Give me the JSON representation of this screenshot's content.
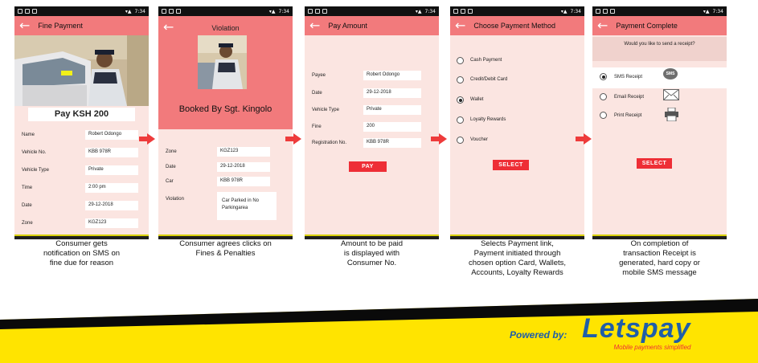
{
  "status": {
    "time": "7:34"
  },
  "screen1": {
    "title": "Fine Payment",
    "pay_label": "Pay KSH 200",
    "rows": [
      {
        "label": "Name",
        "value": "Robert Odongo"
      },
      {
        "label": "Vehicle No.",
        "value": "KBB 978R"
      },
      {
        "label": "Vehicle Type",
        "value": "Private"
      },
      {
        "label": "Time",
        "value": "2:00 pm"
      },
      {
        "label": "Date",
        "value": "29-12-2018"
      },
      {
        "label": "Zone",
        "value": "KGZ123"
      }
    ],
    "caption": [
      "Consumer gets",
      "notification on SMS on",
      "fine due for reason"
    ]
  },
  "screen2": {
    "title": "Violation",
    "booked_by": "Booked By Sgt. Kingolo",
    "rows": [
      {
        "label": "Zone",
        "value": "KGZ123"
      },
      {
        "label": "Date",
        "value": "29-12-2018"
      },
      {
        "label": "Car",
        "value": "KBB 978R"
      },
      {
        "label": "Violation",
        "value": "Car Parked in No Parkingarea"
      }
    ],
    "caption": [
      "Consumer agrees clicks on",
      "Fines & Penalties"
    ]
  },
  "screen3": {
    "title": "Pay Amount",
    "rows": [
      {
        "label": "Payee",
        "value": "Robert Odongo"
      },
      {
        "label": "Date",
        "value": "29-12-2018"
      },
      {
        "label": "Vehicle Type",
        "value": "Private"
      },
      {
        "label": "Fine",
        "value": "200"
      },
      {
        "label": "Registration No.",
        "value": "KBB 978R"
      }
    ],
    "button": "PAY",
    "caption": [
      "Amount to be paid",
      "is displayed with",
      "Consumer No."
    ]
  },
  "screen4": {
    "title": "Choose Payment Method",
    "options": [
      "Cash Payment",
      "Credit/Debit Card",
      "Wallet",
      "Loyalty Rewards",
      "Voucher"
    ],
    "selected": "Wallet",
    "button": "SELECT",
    "caption": [
      "Selects Payment link,",
      "Payment initiated through",
      "chosen option Card, Wallets,",
      "Accounts, Loyalty Rewards"
    ]
  },
  "screen5": {
    "title": "Payment Complete",
    "question": "Would you like to send a receipt?",
    "options": [
      "SMS Receipt",
      "Email Receipt",
      "Print Receipt"
    ],
    "selected": "SMS Receipt",
    "sms_badge": "SMS",
    "button": "SELECT",
    "caption": [
      "On completion of",
      "transaction Receipt is",
      "generated, hard copy or",
      "mobile SMS message"
    ]
  },
  "footer": {
    "powered_by": "Powered by:",
    "brand": "Letspay",
    "tagline": "Mobile payments simplified"
  },
  "colors": {
    "appbar": "#f27a7c",
    "screen_bg": "#fbe5e1",
    "accent_red": "#ee2e36",
    "brand_blue": "#1f5ea8",
    "brand_yellow": "#ffe400"
  }
}
